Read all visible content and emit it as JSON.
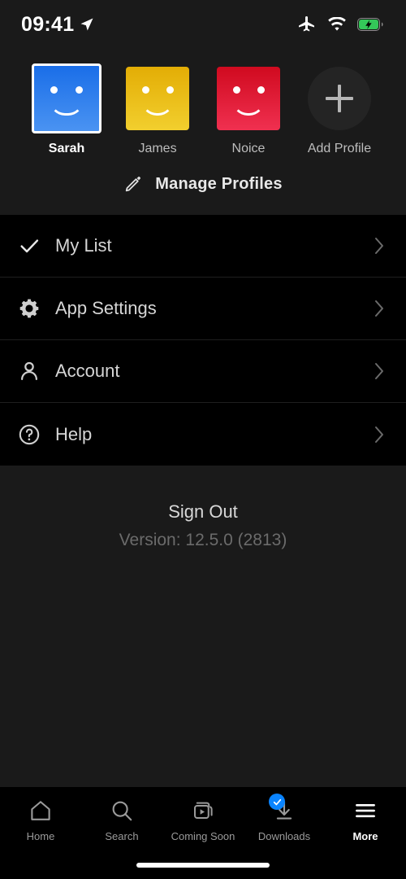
{
  "status_bar": {
    "time": "09:41",
    "icons": [
      "location-arrow-icon",
      "airplane-mode-icon",
      "wifi-icon",
      "battery-charging-icon"
    ],
    "battery_color": "#34c759"
  },
  "profiles": {
    "items": [
      {
        "name": "Sarah",
        "color": "#2b7ced",
        "selected": true,
        "avatar": "smiley-avatar-blue"
      },
      {
        "name": "James",
        "color": "#e8bc10",
        "selected": false,
        "avatar": "smiley-avatar-yellow"
      },
      {
        "name": "Noice",
        "color": "#e11a2d",
        "selected": false,
        "avatar": "smiley-avatar-red"
      }
    ],
    "add_profile_label": "Add Profile",
    "add_profile_icon": "plus-icon",
    "manage_label": "Manage Profiles",
    "manage_icon": "pencil-icon"
  },
  "menu": {
    "items": [
      {
        "label": "My List",
        "icon": "check-icon",
        "chevron": "chevron-right-icon"
      },
      {
        "label": "App Settings",
        "icon": "gear-icon",
        "chevron": "chevron-right-icon"
      },
      {
        "label": "Account",
        "icon": "person-icon",
        "chevron": "chevron-right-icon"
      },
      {
        "label": "Help",
        "icon": "question-circle-icon",
        "chevron": "chevron-right-icon"
      }
    ]
  },
  "footer": {
    "sign_out_label": "Sign Out",
    "version_label": "Version: 12.5.0 (2813)"
  },
  "tab_bar": {
    "items": [
      {
        "label": "Home",
        "icon": "home-icon",
        "active": false,
        "badge": null
      },
      {
        "label": "Search",
        "icon": "search-icon",
        "active": false,
        "badge": null
      },
      {
        "label": "Coming Soon",
        "icon": "coming-soon-icon",
        "active": false,
        "badge": null
      },
      {
        "label": "Downloads",
        "icon": "download-icon",
        "active": false,
        "badge": "check-badge"
      },
      {
        "label": "More",
        "icon": "hamburger-icon",
        "active": true,
        "badge": null
      }
    ],
    "badge_color": "#0a84ff"
  }
}
